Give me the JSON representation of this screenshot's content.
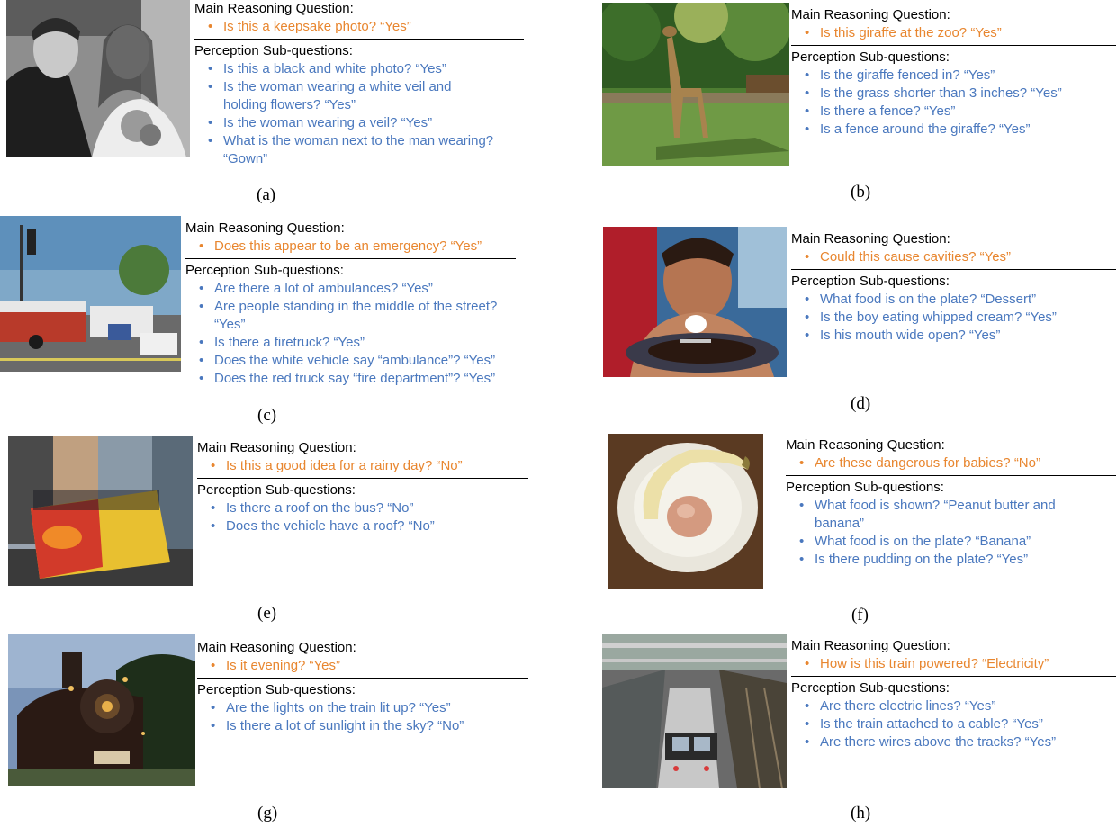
{
  "headers": {
    "main": "Main Reasoning Question:",
    "sub": "Perception Sub-questions:"
  },
  "panels": [
    {
      "caption": "(a)",
      "main_question": "Is this a keepsake photo? “Yes”",
      "sub_questions": [
        "Is this a black and white photo? “Yes”",
        "Is the woman wearing a white veil and holding flowers? “Yes”",
        "Is the woman wearing a veil? “Yes”",
        "What is the woman next to the man wearing? “Gown”"
      ]
    },
    {
      "caption": "(b)",
      "main_question": "Is this giraffe at the zoo? “Yes”",
      "sub_questions": [
        "Is the giraffe fenced in? “Yes”",
        "Is the grass shorter than 3 inches? “Yes”",
        "Is there a fence? “Yes”",
        "Is a fence around the giraffe? “Yes”"
      ]
    },
    {
      "caption": "(c)",
      "main_question": "Does this appear to be an emergency? “Yes”",
      "sub_questions": [
        "Are there a lot of ambulances? “Yes”",
        "Are people standing in the middle of the street? “Yes”",
        "Is there a firetruck? “Yes”",
        "Does the white vehicle say “ambulance”? “Yes”",
        "Does the red truck say “fire department”? “Yes”"
      ]
    },
    {
      "caption": "(d)",
      "main_question": "Could this cause cavities? “Yes”",
      "sub_questions": [
        "What food is on the plate? “Dessert”",
        "Is the boy eating whipped cream? “Yes”",
        "Is his mouth wide open? “Yes”"
      ]
    },
    {
      "caption": "(e)",
      "main_question": "Is this a good idea for a rainy day? “No”",
      "sub_questions": [
        "Is there a roof on the bus? “No”",
        "Does the vehicle have a roof? “No”"
      ]
    },
    {
      "caption": "(f)",
      "main_question": "Are these dangerous for babies? “No”",
      "sub_questions": [
        "What food is shown? “Peanut butter and banana”",
        "What food is on the plate? “Banana”",
        "Is there pudding on the plate? “Yes”"
      ]
    },
    {
      "caption": "(g)",
      "main_question": "Is it evening? “Yes”",
      "sub_questions": [
        "Are the lights on the train lit up? “Yes”",
        "Is there a lot of sunlight in the sky? “No”"
      ]
    },
    {
      "caption": "(h)",
      "main_question": "How is this train powered? “Electricity”",
      "sub_questions": [
        "Are there electric lines? “Yes”",
        "Is the train attached to a cable? “Yes”",
        "Are there wires above the tracks? “Yes”"
      ]
    }
  ]
}
